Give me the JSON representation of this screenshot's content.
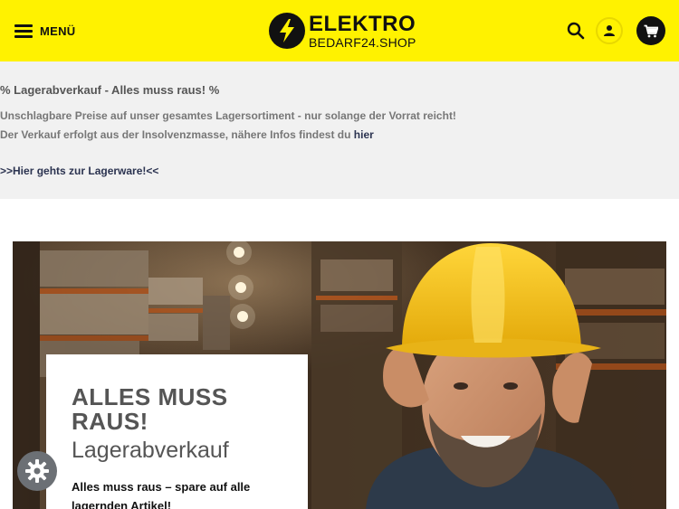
{
  "header": {
    "menu_label": "MENÜ",
    "logo": {
      "line1": "ELEKTRO",
      "line2": "BEDARF24.SHOP"
    },
    "icons": [
      "menu-icon",
      "bolt-icon",
      "search-icon",
      "user-icon",
      "cart-icon"
    ],
    "background_color": "#fff200"
  },
  "notice": {
    "title": "% Lagerabverkauf - Alles muss raus! %",
    "line1": "Unschlagbare Preise auf unser gesamtes Lagersortiment - nur solange der Vorrat reicht!",
    "line2_prefix": "Der Verkauf erfolgt aus der Insolvenzmasse, nähere Infos findest du ",
    "line2_link": "hier",
    "cta": ">>Hier gehts zur Lagerware!<<"
  },
  "hero": {
    "heading": "ALLES MUSS RAUS!",
    "subheading": "Lagerabverkauf",
    "text": "Alles muss raus – spare auf alle lagernden Artikel!"
  },
  "floating_button": {
    "icon": "settings-gear-icon"
  }
}
